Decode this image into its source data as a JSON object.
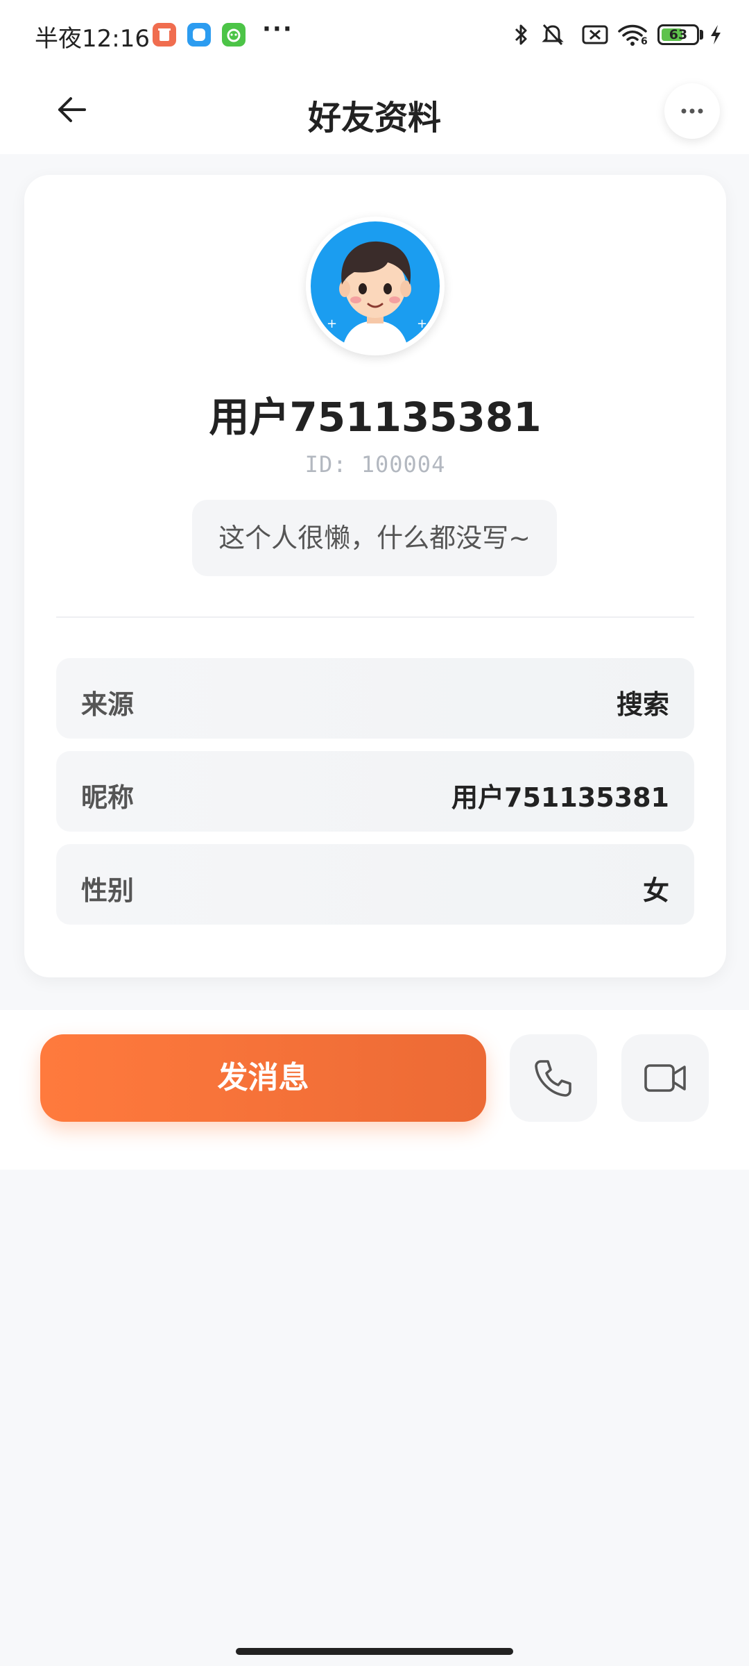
{
  "status_bar": {
    "time": "半夜12:16",
    "more_dots": "···",
    "battery_level": "63",
    "battery_fraction": 0.63,
    "wifi_badge": "6"
  },
  "header": {
    "title": "好友资料"
  },
  "profile": {
    "name": "用户751135381",
    "id_text": "ID: 100004",
    "bio": "这个人很懒，什么都没写~"
  },
  "info_rows": [
    {
      "label": "来源",
      "value": "搜索"
    },
    {
      "label": "昵称",
      "value": "用户751135381"
    },
    {
      "label": "性别",
      "value": "女"
    }
  ],
  "actions": {
    "send_message": "发消息",
    "voice_call_icon": "phone-icon",
    "video_call_icon": "video-icon"
  },
  "colors": {
    "accent": "#ff7a3d",
    "background": "#f7f8fa"
  }
}
